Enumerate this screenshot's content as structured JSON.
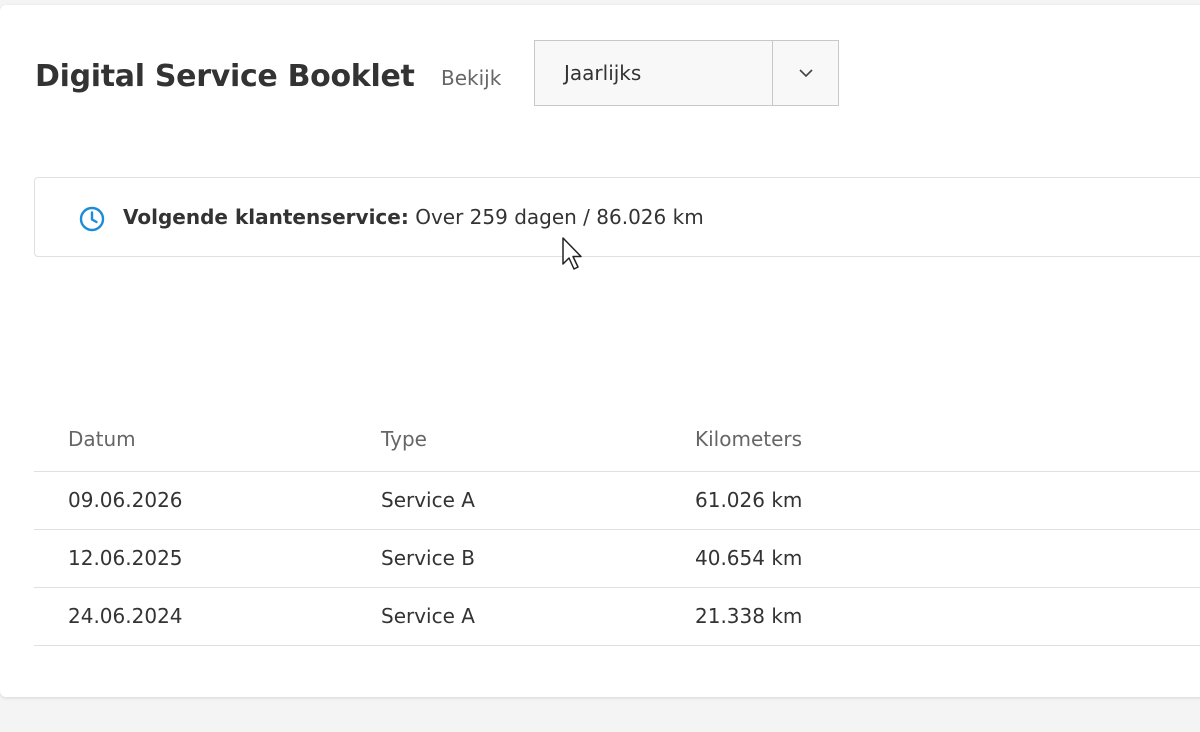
{
  "header": {
    "title": "Digital Service Booklet",
    "view_label": "Bekijk",
    "view_select": {
      "value": "Jaarlijks",
      "chevron_icon": "chevron-down-icon"
    }
  },
  "notice": {
    "icon": "clock-icon",
    "label": "Volgende klantenservice:",
    "value": " Over 259 dagen / 86.026 km",
    "accent_color": "#1a8cd8"
  },
  "table": {
    "columns": [
      "Datum",
      "Type",
      "Kilometers"
    ],
    "rows": [
      {
        "date": "09.06.2026",
        "type": "Service A",
        "km": "61.026 km"
      },
      {
        "date": "12.06.2025",
        "type": "Service B",
        "km": "40.654 km"
      },
      {
        "date": "24.06.2024",
        "type": "Service A",
        "km": "21.338 km"
      }
    ]
  }
}
